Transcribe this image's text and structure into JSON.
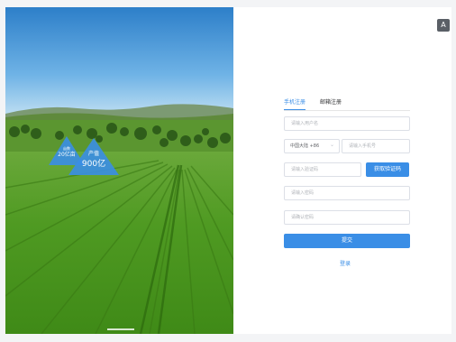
{
  "hero": {
    "badge_small_line1": "亩数",
    "badge_small_line2": "20亿亩",
    "badge_large_line1": "产值",
    "badge_large_line2": "900亿"
  },
  "header": {
    "language_icon": "translate-icon"
  },
  "tabs": [
    {
      "label": "手机注册",
      "active": true
    },
    {
      "label": "邮箱注册",
      "active": false
    }
  ],
  "form": {
    "username_placeholder": "请输入用户名",
    "country_code": "中国大陆  +86",
    "phone_placeholder": "请输入手机号",
    "code_placeholder": "请输入验证码",
    "get_code_label": "获取验证码",
    "password_placeholder": "请输入密码",
    "confirm_password_placeholder": "请确认密码",
    "submit_label": "提交",
    "login_link": "登录"
  },
  "colors": {
    "primary": "#3a8ee6",
    "border": "#dcdfe6",
    "badge": "#3a8ee6"
  }
}
